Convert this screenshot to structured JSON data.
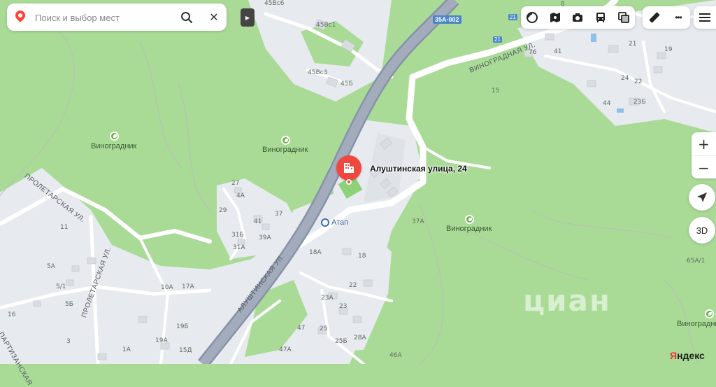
{
  "search": {
    "placeholder": "Поиск и выбор мест"
  },
  "road_shield": "35А-002",
  "road_number_badges": [
    "21",
    "21"
  ],
  "marker": {
    "address": "Алуштинская улица, 24"
  },
  "poi": {
    "label": "Атап"
  },
  "areas": [
    "Виноградник",
    "Виноградник",
    "Виноградник",
    "Виноградник"
  ],
  "streets": {
    "alushta": "АЛУШТИНСКАЯ УЛ.",
    "vinograd": "ВИНОГРАДНАЯ УЛ.",
    "proletar_1": "ПРОЛЕТАРСКАЯ УЛ.",
    "proletar_2": "ПРОЛЕТАРСКАЯ УЛ.",
    "partizan": "ПАРТИЗАНСКАЯ"
  },
  "house_numbers": {
    "h45v6": "45Вс6",
    "h45v1": "45Вс1",
    "h45v3": "45Вс3",
    "h45b": "45Б",
    "h8": "8",
    "h76": "76",
    "h41a": "41",
    "h21": "21",
    "h19": "19",
    "h15": "15",
    "h24": "24",
    "h22": "22",
    "h44": "44",
    "h23b": "23Б",
    "h27": "27",
    "h4a": "4А",
    "h29": "29",
    "h37": "37",
    "h41": "41",
    "h31b": "31Б",
    "h39a": "39А",
    "h31a": "31А",
    "h11": "11",
    "h5a": "5А",
    "h5_1": "5/1",
    "h5b": "5Б",
    "h10a": "10А",
    "h17a": "17А",
    "h18a": "18А",
    "h18": "18",
    "h22b": "22",
    "h23a": "23А",
    "h23": "23",
    "h25": "25",
    "h25b": "25Б",
    "h28a": "28А",
    "h47": "47",
    "h47a": "47А",
    "h46a": "46А",
    "h19b": "19Б",
    "h19a": "19А",
    "h15d": "15Д",
    "h1a": "1А",
    "h3": "3",
    "h16": "16",
    "h37a": "37А",
    "h65a1": "65А/1"
  },
  "controls": {
    "zoom_in": "+",
    "zoom_out": "−",
    "btn_3d": "3D",
    "close": "✕",
    "play": "▶",
    "more": "•••"
  },
  "toolbar_icons": [
    "layers-icon",
    "panorama-icon",
    "camera-icon",
    "transit-icon",
    "traffic-icon"
  ],
  "watermark": "циан",
  "brand": [
    "Я",
    "ндекс"
  ],
  "colors": {
    "green": "#a9db97",
    "road_main": "#9aa3b5",
    "road_secondary": "#ffffff",
    "urban": "#e8ebee",
    "marker": "#f0483e",
    "shield": "#4a86c8"
  }
}
